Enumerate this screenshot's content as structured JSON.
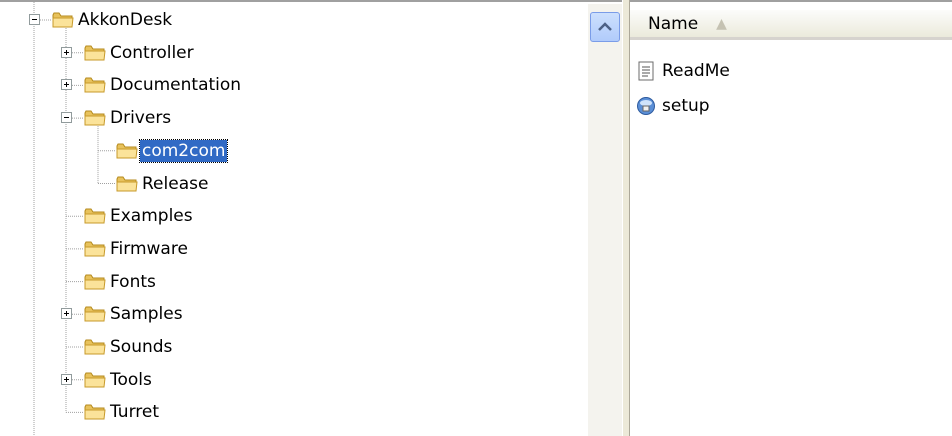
{
  "tree": {
    "items": [
      {
        "label": "AkkonDesk",
        "expander": "minus",
        "level": 0
      },
      {
        "label": "Controller",
        "expander": "plus",
        "level": 1
      },
      {
        "label": "Documentation",
        "expander": "plus",
        "level": 1
      },
      {
        "label": "Drivers",
        "expander": "minus",
        "level": 1
      },
      {
        "label": "com2com",
        "expander": "none",
        "level": 2,
        "selected": true
      },
      {
        "label": "Release",
        "expander": "none",
        "level": 2
      },
      {
        "label": "Examples",
        "expander": "none",
        "level": 1
      },
      {
        "label": "Firmware",
        "expander": "none",
        "level": 1
      },
      {
        "label": "Fonts",
        "expander": "none",
        "level": 1
      },
      {
        "label": "Samples",
        "expander": "plus",
        "level": 1
      },
      {
        "label": "Sounds",
        "expander": "none",
        "level": 1
      },
      {
        "label": "Tools",
        "expander": "plus",
        "level": 1
      },
      {
        "label": "Turret",
        "expander": "none",
        "level": 1
      }
    ]
  },
  "list": {
    "column_header": "Name",
    "sort_indicator": "▲",
    "files": [
      {
        "name": "ReadMe",
        "icon": "text-document-icon"
      },
      {
        "name": "setup",
        "icon": "setup-installer-icon"
      }
    ]
  },
  "colors": {
    "selection": "#316ac5",
    "folder": "#f7d87c",
    "scroll_button": "#b1cbfb"
  }
}
